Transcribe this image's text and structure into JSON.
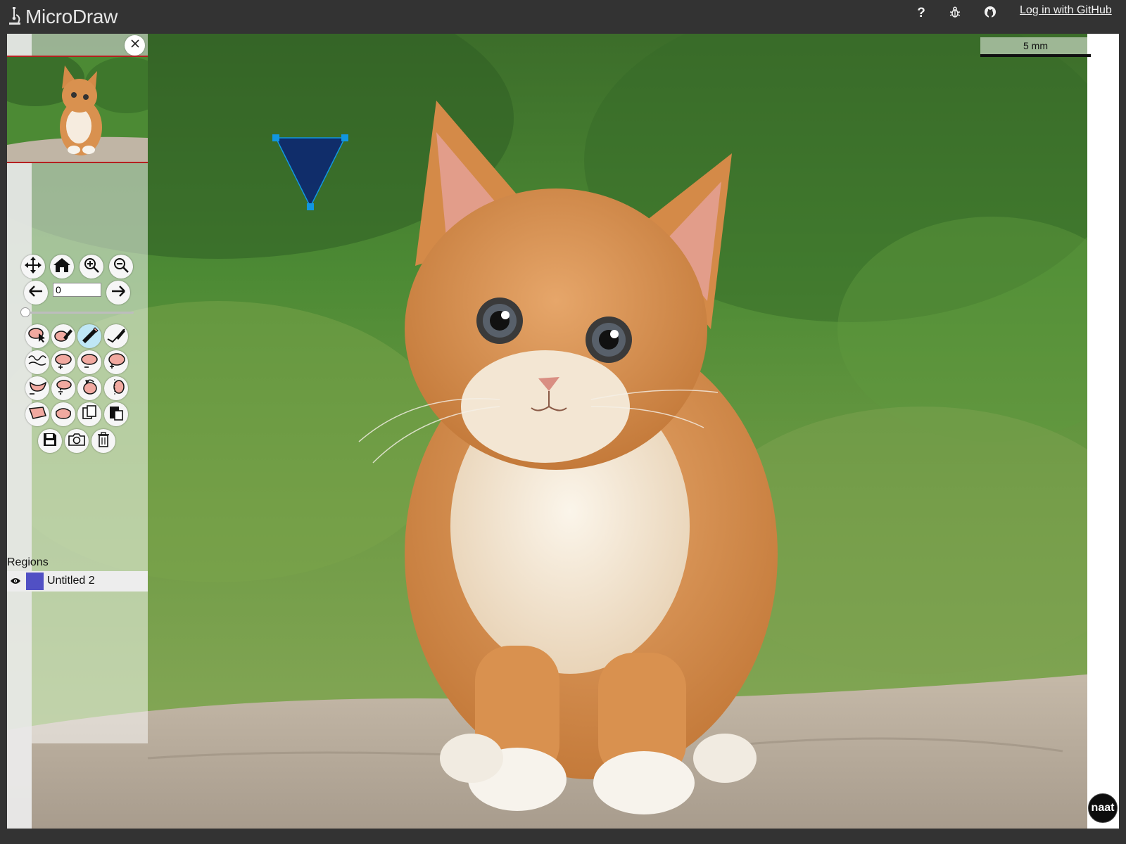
{
  "app": {
    "name": "MicroDraw"
  },
  "topbar": {
    "help_label": "?",
    "help_icon": "question-icon",
    "bug_icon": "bug-icon",
    "github_icon": "github-icon",
    "login_label": "Log in with GitHub"
  },
  "navigator": {
    "close_icon": "close-icon"
  },
  "toolbar": {
    "nav_tools": [
      "move-icon",
      "home-icon",
      "zoom-in-icon",
      "zoom-out-icon"
    ],
    "slice_value": "0",
    "slice_prev_icon": "arrow-left-icon",
    "slice_next_icon": "arrow-right-icon",
    "slice_slider_level": 0,
    "active_tool": "add-points-icon"
  },
  "regions": {
    "title": "Regions",
    "items": [
      {
        "name": "Untitled 2",
        "color": "#5150c4",
        "visible": true
      }
    ]
  },
  "viewer": {
    "scale_label": "5 mm",
    "annotation_color": "#0e2a6e",
    "handle_color": "#1196e0"
  },
  "badge": {
    "label": "naat"
  }
}
